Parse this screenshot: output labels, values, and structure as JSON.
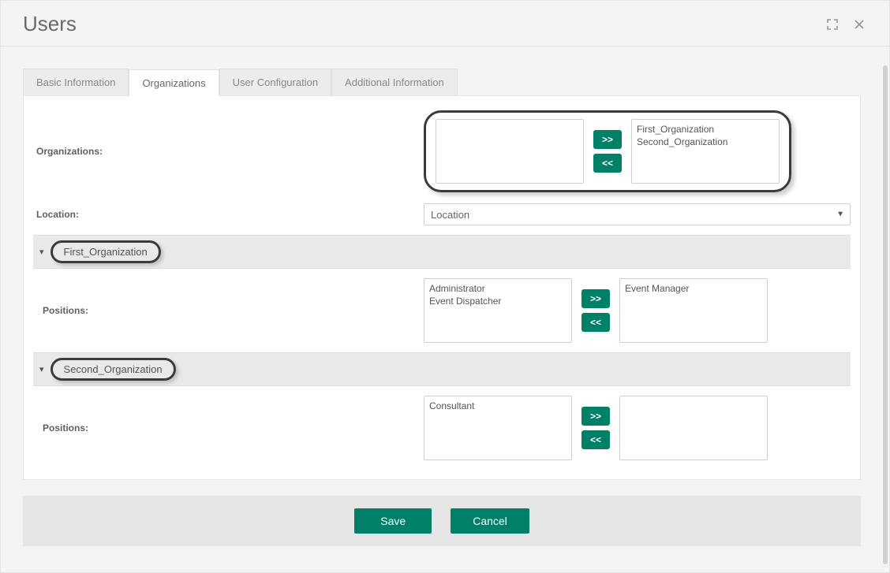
{
  "dialog": {
    "title": "Users"
  },
  "tabs": [
    {
      "label": "Basic Information"
    },
    {
      "label": "Organizations"
    },
    {
      "label": "User Configuration"
    },
    {
      "label": "Additional Information"
    }
  ],
  "labels": {
    "organizations": "Organizations:",
    "location": "Location:",
    "positions": "Positions:"
  },
  "location": {
    "placeholder": "Location"
  },
  "orgs": {
    "available": [],
    "selected": [
      "First_Organization",
      "Second_Organization"
    ]
  },
  "groups": [
    {
      "name": "First_Organization",
      "positions": {
        "available": [
          "Administrator",
          "Event Dispatcher"
        ],
        "selected": [
          "Event Manager"
        ]
      }
    },
    {
      "name": "Second_Organization",
      "positions": {
        "available": [
          "Consultant"
        ],
        "selected": []
      }
    }
  ],
  "buttons": {
    "move_right": ">>",
    "move_left": "<<",
    "save": "Save",
    "cancel": "Cancel"
  }
}
